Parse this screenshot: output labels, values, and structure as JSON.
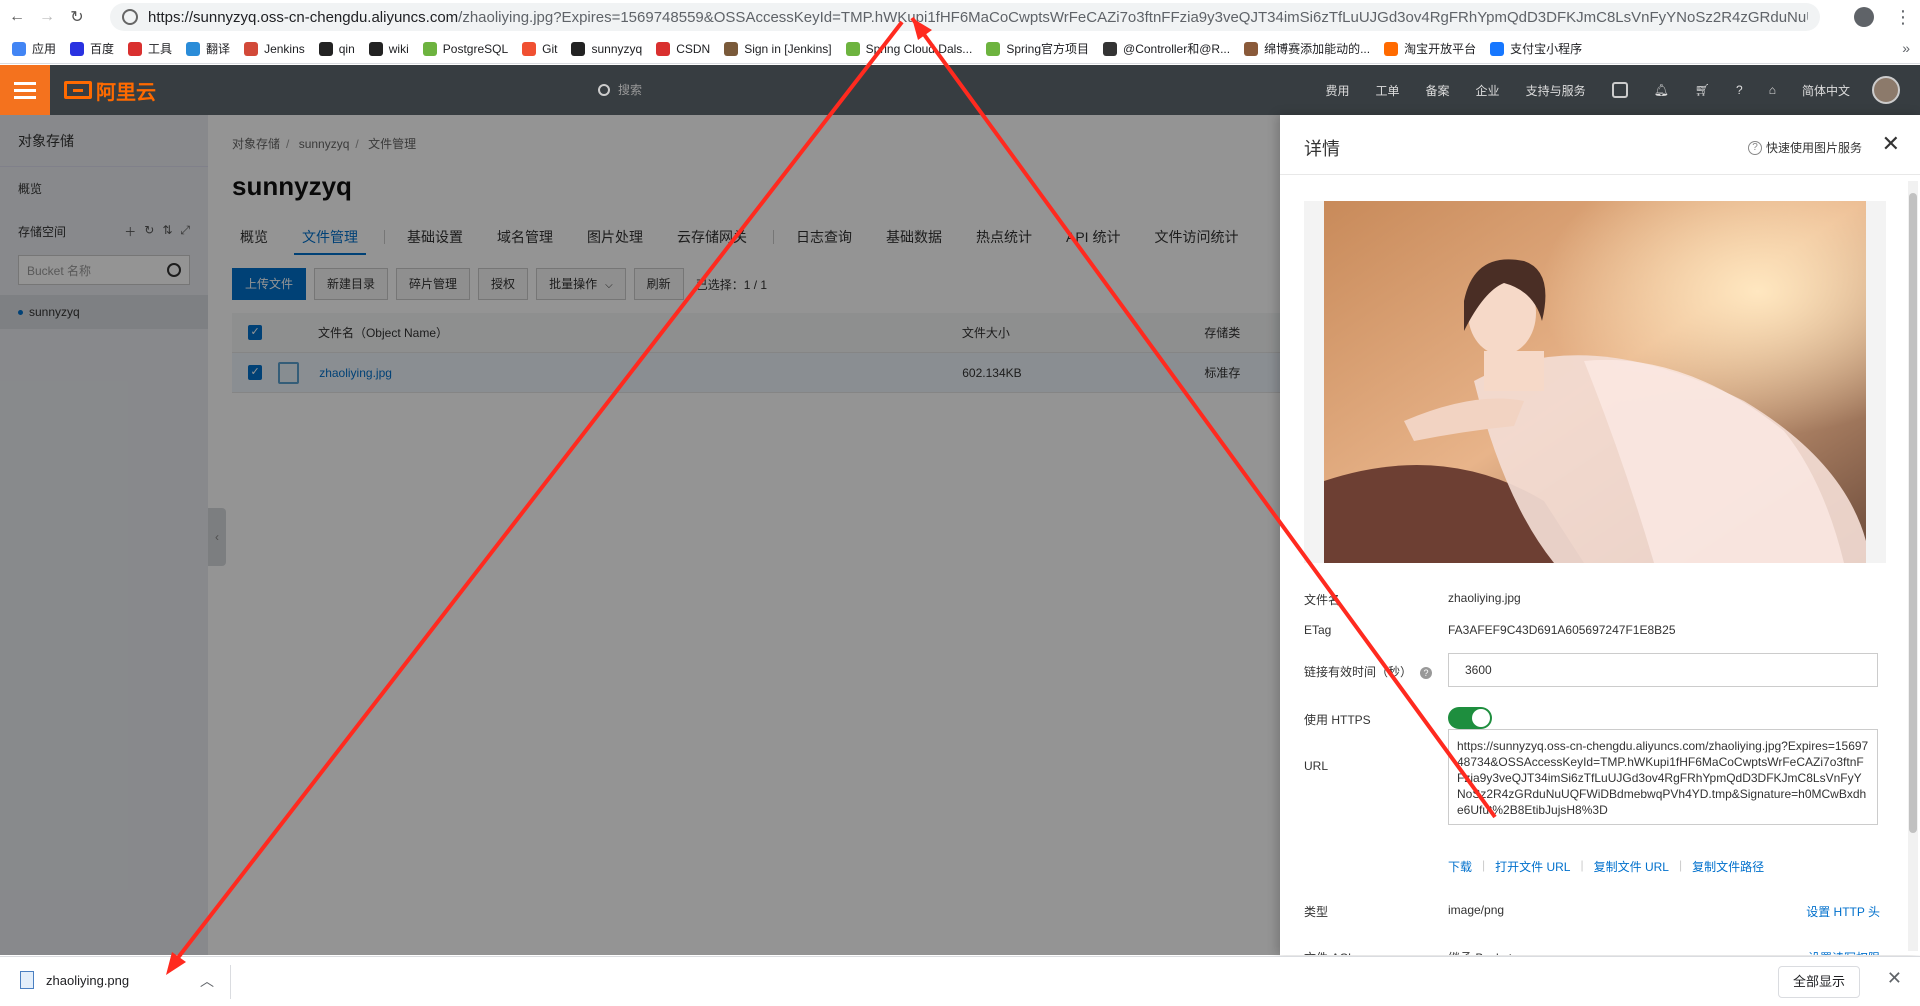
{
  "browser": {
    "url_host": "https://sunnyzyq.oss-cn-chengdu.aliyuncs.com",
    "url_rest": "/zhaoliying.jpg?Expires=1569748559&OSSAccessKeyId=TMP.hWKupi1fHF6MaCoCwptsWrFeCAZi7o3ftnFFzia9y3veQJT34imSi6zTfLuUJGd3ov4RgFRhYpmQdD3DFKJmC8LsVnFyYNoSz2R4zGRduNuUQFWi..."
  },
  "bookmarks": [
    {
      "label": "应用",
      "color": "#4285f4"
    },
    {
      "label": "百度",
      "color": "#2932e1"
    },
    {
      "label": "工具",
      "color": "#d9302f"
    },
    {
      "label": "翻译",
      "color": "#2a8cd8"
    },
    {
      "label": "Jenkins",
      "color": "#d24939"
    },
    {
      "label": "qin",
      "color": "#222222"
    },
    {
      "label": "wiki",
      "color": "#222222"
    },
    {
      "label": "PostgreSQL",
      "color": "#6db33f"
    },
    {
      "label": "Git",
      "color": "#f05032"
    },
    {
      "label": "sunnyzyq",
      "color": "#222222"
    },
    {
      "label": "CSDN",
      "color": "#d9302f"
    },
    {
      "label": "Sign in [Jenkins]",
      "color": "#7a5a3a"
    },
    {
      "label": "Spring Cloud Dals...",
      "color": "#6db33f"
    },
    {
      "label": "Spring官方项目",
      "color": "#6db33f"
    },
    {
      "label": "@Controller和@R...",
      "color": "#333333"
    },
    {
      "label": "绵博赛添加能动的...",
      "color": "#8a5a3a"
    },
    {
      "label": "淘宝开放平台",
      "color": "#ff6a00"
    },
    {
      "label": "支付宝小程序",
      "color": "#1677ff"
    }
  ],
  "topbar": {
    "logo": "阿里云",
    "search_placeholder": "搜索",
    "nav": [
      "费用",
      "工单",
      "备案",
      "企业",
      "支持与服务"
    ],
    "lang": "简体中文"
  },
  "sidebar": {
    "title": "对象存储",
    "overview": "概览",
    "storage_label": "存储空间",
    "search_placeholder": "Bucket 名称",
    "bucket": "sunnyzyq"
  },
  "main": {
    "breadcrumb": [
      "对象存储",
      "sunnyzyq",
      "文件管理"
    ],
    "title": "sunnyzyq",
    "tabs": [
      "概览",
      "文件管理",
      "基础设置",
      "域名管理",
      "图片处理",
      "云存储网关",
      "日志查询",
      "基础数据",
      "热点统计",
      "API 统计",
      "文件访问统计"
    ],
    "buttons": [
      "上传文件",
      "新建目录",
      "碎片管理",
      "授权",
      "批量操作",
      "刷新"
    ],
    "selected": "已选择：1 / 1",
    "columns": [
      "文件名（Object Name）",
      "文件大小",
      "存储类"
    ],
    "row": {
      "name": "zhaoliying.jpg",
      "size": "602.134KB",
      "type": "标准存"
    }
  },
  "panel": {
    "title": "详情",
    "quick": "快速使用图片服务",
    "filename_label": "文件名",
    "filename": "zhaoliying.jpg",
    "etag_label": "ETag",
    "etag": "FA3AFEF9C43D691A605697247F1E8B25",
    "expire_label": "链接有效时间（秒）",
    "expire": "3600",
    "https_label": "使用 HTTPS",
    "https_on": true,
    "url_label": "URL",
    "url": "https://sunnyzyq.oss-cn-chengdu.aliyuncs.com/zhaoliying.jpg?Expires=1569748734&OSSAccessKeyId=TMP.hWKupi1fHF6MaCoCwptsWrFeCAZi7o3ftnFFzia9y3veQJT34imSi6zTfLuUJGd3ov4RgFRhYpmQdD3DFKJmC8LsVnFyYNoSz2R4zGRduNuUQFWiDBdmebwqPVh4YD.tmp&Signature=h0MCwBxdhe6Ufut%2B8EtibJujsH8%3D",
    "actions": [
      "下载",
      "打开文件 URL",
      "复制文件 URL",
      "复制文件路径"
    ],
    "type_label": "类型",
    "type": "image/png",
    "set_http": "设置 HTTP 头",
    "acl_label": "文件 ACL",
    "acl": "继承 Bucket",
    "set_acl": "设置读写权限"
  },
  "downloads": {
    "file": "zhaoliying.png",
    "show_all": "全部显示"
  },
  "colors": {
    "accent": "#0070cc",
    "brand": "#ff6a00",
    "annotation": "#ff2a1f"
  }
}
